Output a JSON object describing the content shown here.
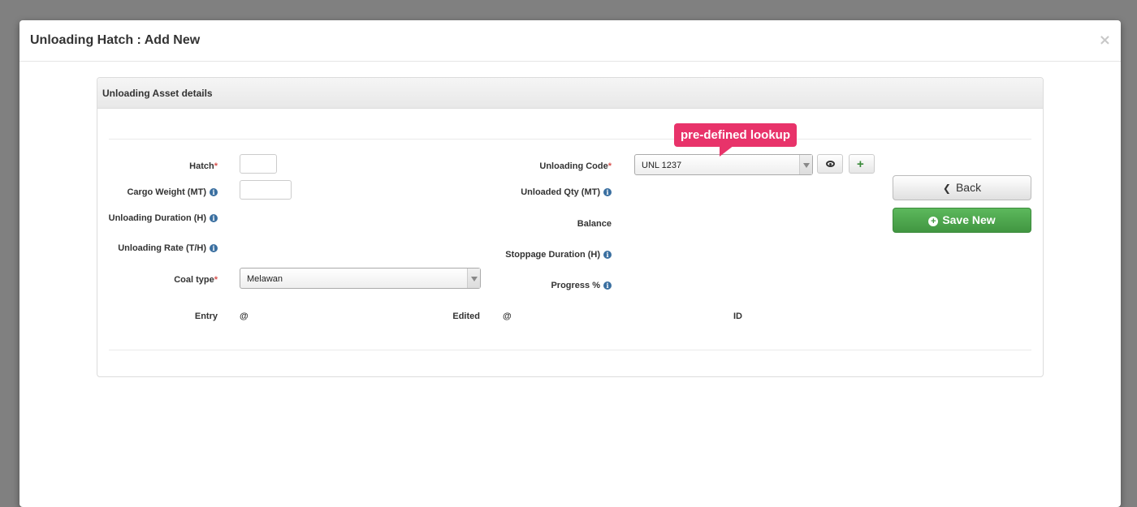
{
  "modal": {
    "title": "Unloading Hatch : Add New",
    "close_glyph": "×"
  },
  "panel": {
    "title": "Unloading Asset details"
  },
  "tooltip": {
    "text": "pre-defined lookup"
  },
  "left_fields": {
    "hatch_label": "Hatch",
    "cargo_weight_label": "Cargo Weight (MT)",
    "unloading_duration_label": "Unloading Duration (H)",
    "unloading_rate_label": "Unloading Rate (T/H)",
    "coal_type_label": "Coal type",
    "coal_type_value": "Melawan",
    "hatch_value": "",
    "cargo_weight_value": ""
  },
  "right_fields": {
    "unloading_code_label": "Unloading Code",
    "unloading_code_value": "UNL 1237",
    "unloaded_qty_label": "Unloaded Qty (MT)",
    "balance_label": "Balance",
    "stoppage_duration_label": "Stoppage Duration (H)",
    "progress_label": "Progress %"
  },
  "meta": {
    "entry_label": "Entry",
    "entry_value": "@",
    "edited_label": "Edited",
    "edited_value": "@",
    "id_label": "ID"
  },
  "buttons": {
    "back_label": "Back",
    "save_new_label": "Save New"
  },
  "required_marker": "*",
  "info_glyph": "i",
  "icons": {
    "back": "chevron-left-icon",
    "save": "plus-circle-icon",
    "view": "eye-icon",
    "add": "plus-icon"
  },
  "colors": {
    "save_green": "#5cb85c",
    "tooltip_pink": "#e8336a",
    "required_red": "#d9534f"
  }
}
